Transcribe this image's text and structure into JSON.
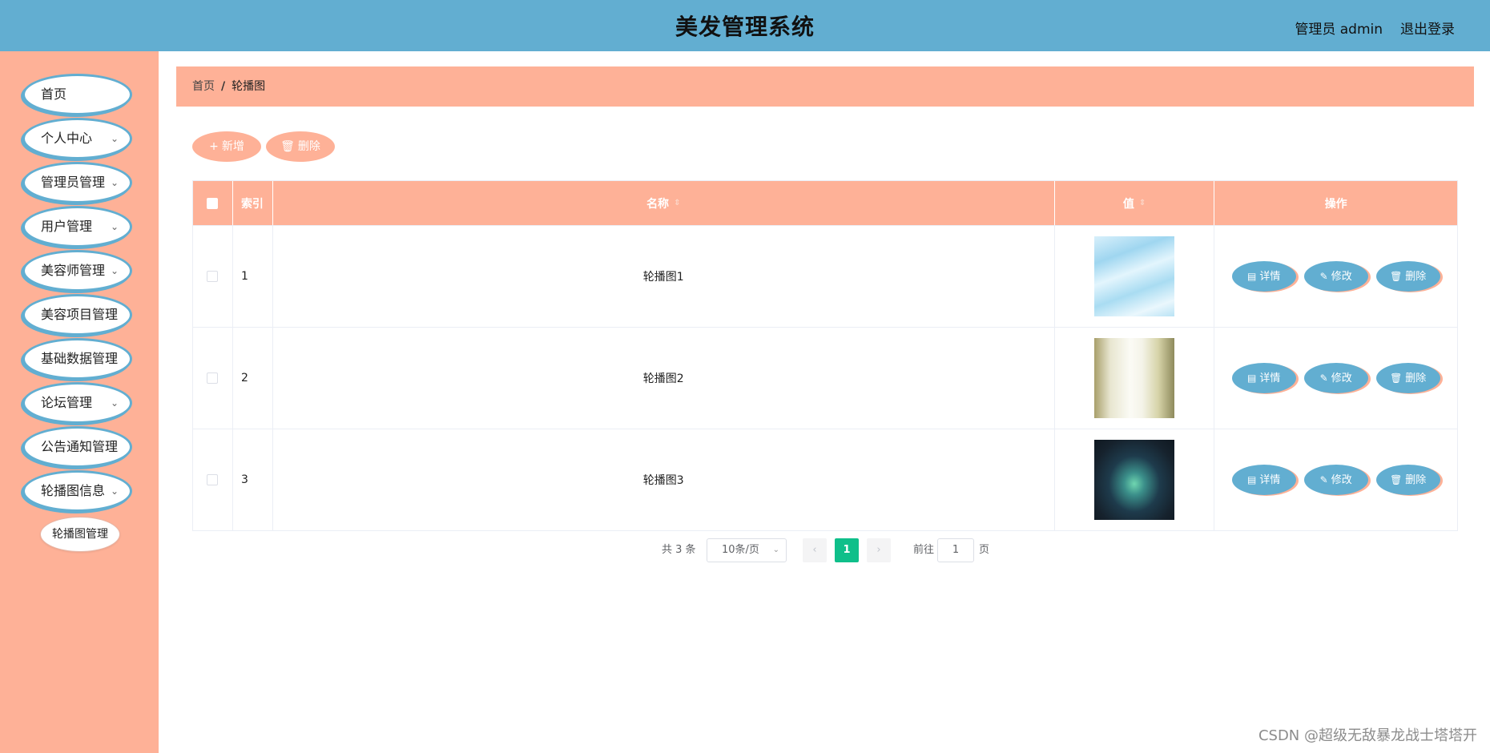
{
  "header": {
    "title": "美发管理系统",
    "user": "管理员 admin",
    "logout": "退出登录"
  },
  "sidebar": {
    "items": [
      {
        "label": "首页",
        "has_children": false
      },
      {
        "label": "个人中心",
        "has_children": true
      },
      {
        "label": "管理员管理",
        "has_children": true
      },
      {
        "label": "用户管理",
        "has_children": true
      },
      {
        "label": "美容师管理",
        "has_children": true
      },
      {
        "label": "美容项目管理",
        "has_children": true
      },
      {
        "label": "基础数据管理",
        "has_children": true
      },
      {
        "label": "论坛管理",
        "has_children": true
      },
      {
        "label": "公告通知管理",
        "has_children": true
      },
      {
        "label": "轮播图信息",
        "has_children": true
      }
    ],
    "subitems": [
      {
        "label": "轮播图管理"
      }
    ]
  },
  "breadcrumb": {
    "home": "首页",
    "separator": "/",
    "current": "轮播图"
  },
  "toolbar": {
    "add_label": "新增",
    "delete_label": "删除"
  },
  "table": {
    "headers": {
      "index": "索引",
      "name": "名称",
      "value": "值",
      "ops": "操作"
    },
    "rows": [
      {
        "index": "1",
        "name": "轮播图1",
        "image": "light-blue-texture"
      },
      {
        "index": "2",
        "name": "轮播图2",
        "image": "bright-interior"
      },
      {
        "index": "3",
        "name": "轮播图3",
        "image": "dark-aurora"
      }
    ],
    "row_actions": {
      "detail": "详情",
      "edit": "修改",
      "delete": "删除"
    }
  },
  "pagination": {
    "total": "共 3 条",
    "page_size": "10条/页",
    "current_page": "1",
    "goto_label": "前往",
    "goto_value": "1",
    "unit": "页"
  },
  "watermark": "CSDN @超级无敌暴龙战士塔塔开",
  "colors": {
    "header": "#62aed1",
    "accent": "#feb197",
    "active_page": "#0fbf8a"
  }
}
